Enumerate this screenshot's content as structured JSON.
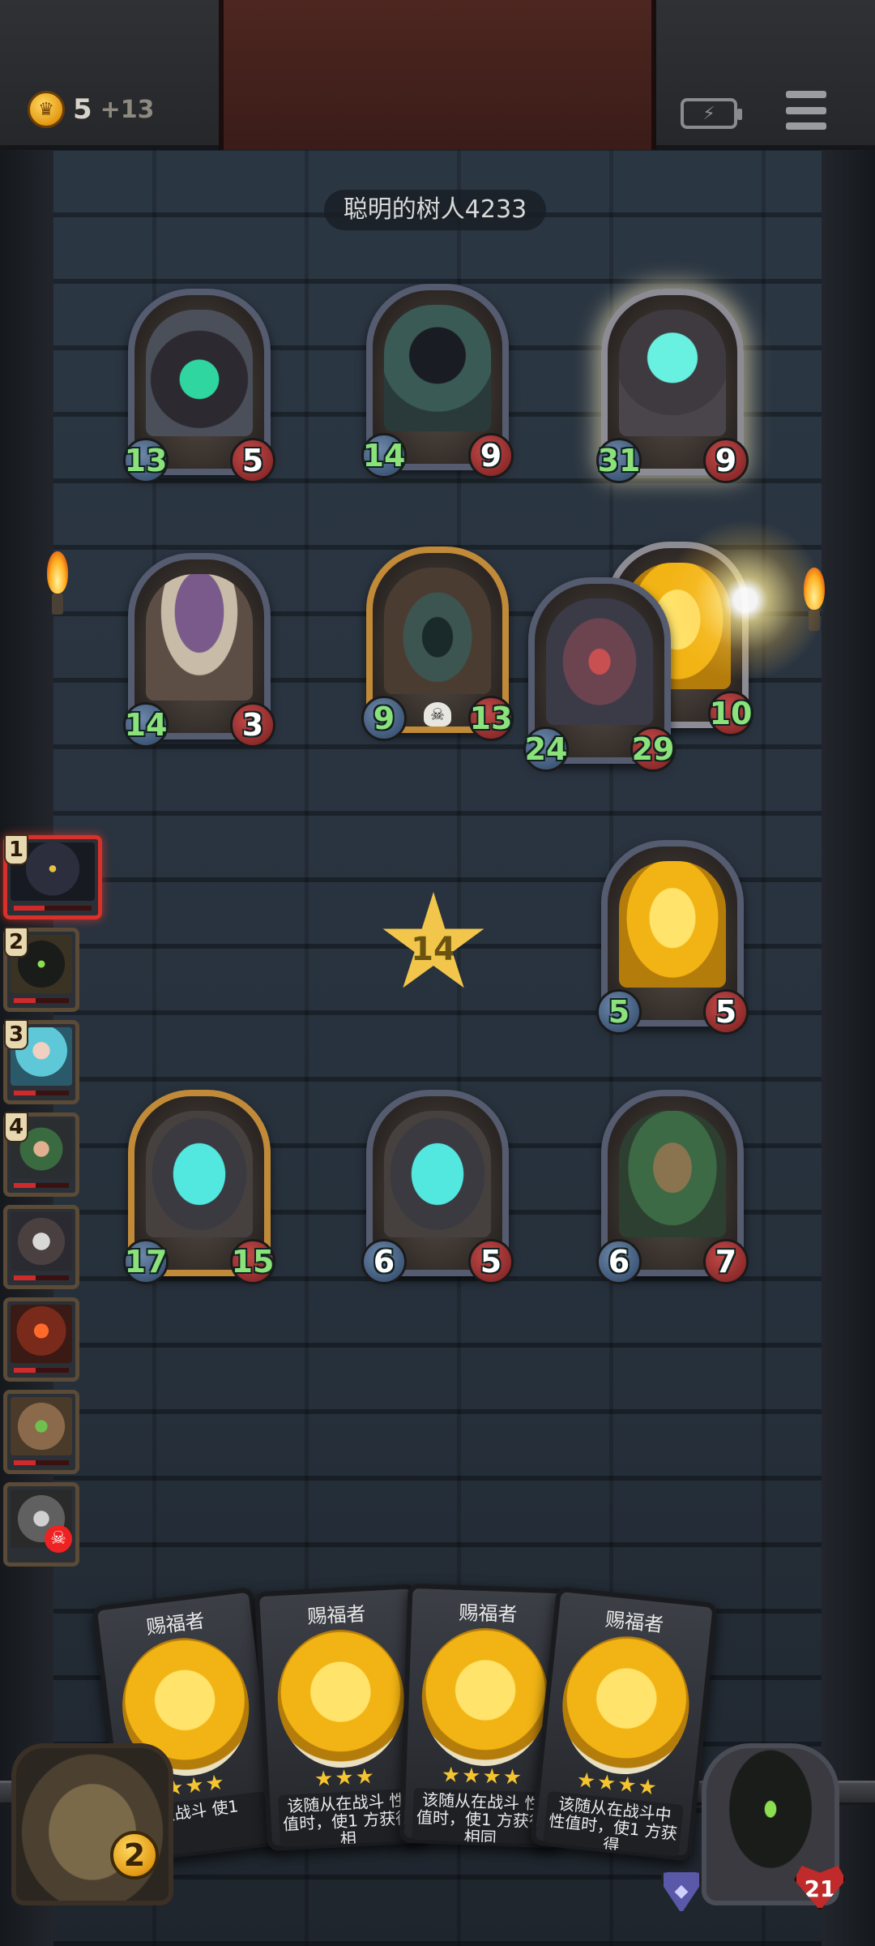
{
  "hud": {
    "gold": "5",
    "gold_income": "+13",
    "opponent_name": "聪明的树人4233"
  },
  "timer": "14",
  "enemy_minions": [
    {
      "atk": "13",
      "hp": "5",
      "theme": "demon"
    },
    {
      "atk": "14",
      "hp": "9",
      "theme": "reaper"
    },
    {
      "atk": "31",
      "hp": "9",
      "theme": "spirit"
    },
    {
      "atk": "14",
      "hp": "3",
      "theme": "mushroom"
    },
    {
      "atk": "9",
      "hp": "13",
      "theme": "chest"
    },
    {
      "atk": "24",
      "hp": "29",
      "theme": "hound"
    },
    {
      "atk": "",
      "hp": "10",
      "theme": "gold"
    }
  ],
  "player_minions": [
    {
      "atk": "5",
      "hp": "5",
      "theme": "gold"
    },
    {
      "atk": "17",
      "hp": "15",
      "theme": "ghost"
    },
    {
      "atk": "6",
      "hp": "5",
      "theme": "ghost"
    },
    {
      "atk": "6",
      "hp": "7",
      "theme": "tree"
    }
  ],
  "turn_order": [
    "1",
    "2",
    "3",
    "4"
  ],
  "hand": [
    {
      "name": "赐福者",
      "desc": "在战斗 使1"
    },
    {
      "name": "赐福者",
      "desc": "该随从在战斗 性值时，使1 方获得相"
    },
    {
      "name": "赐福者",
      "desc": "该随从在战斗 性值时，使1 方获得相同"
    },
    {
      "name": "赐福者",
      "desc": "该随从在战斗中 性值时，使1 方获得"
    }
  ],
  "deck_count": "2",
  "hero_hp": "21"
}
